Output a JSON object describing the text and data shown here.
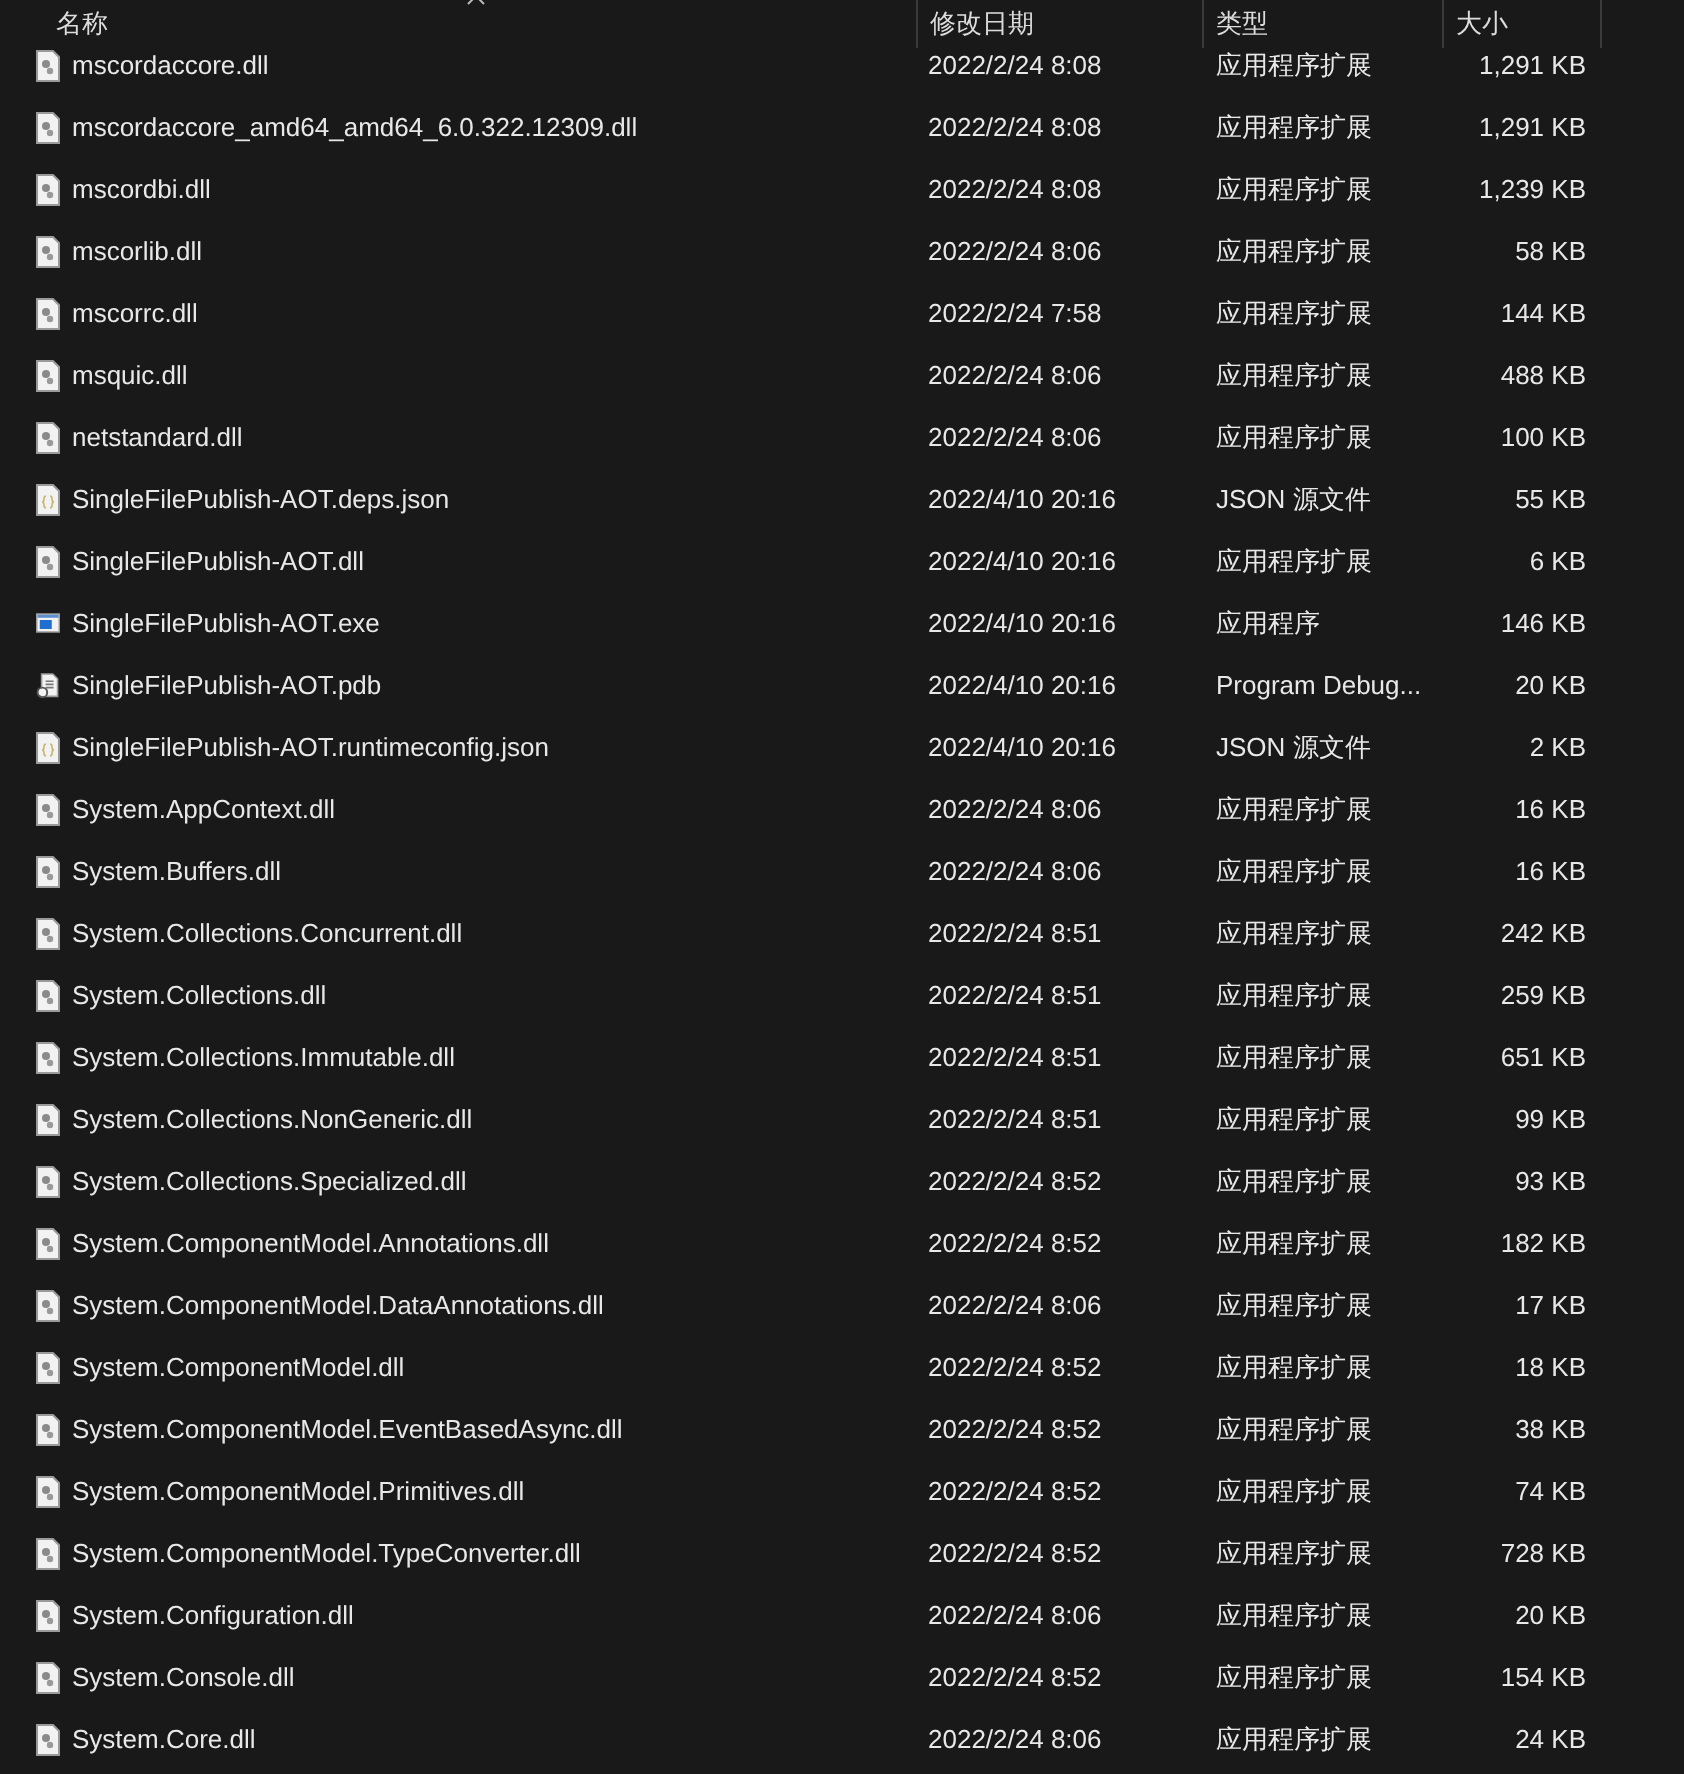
{
  "columns": [
    {
      "label": "名称",
      "sorted": true
    },
    {
      "label": "修改日期",
      "sorted": false
    },
    {
      "label": "类型",
      "sorted": false
    },
    {
      "label": "大小",
      "sorted": false
    }
  ],
  "files": [
    {
      "kind": "dll",
      "name": "mscordaccore.dll",
      "date": "2022/2/24 8:08",
      "type": "应用程序扩展",
      "size": "1,291 KB"
    },
    {
      "kind": "dll",
      "name": "mscordaccore_amd64_amd64_6.0.322.12309.dll",
      "date": "2022/2/24 8:08",
      "type": "应用程序扩展",
      "size": "1,291 KB"
    },
    {
      "kind": "dll",
      "name": "mscordbi.dll",
      "date": "2022/2/24 8:08",
      "type": "应用程序扩展",
      "size": "1,239 KB"
    },
    {
      "kind": "dll",
      "name": "mscorlib.dll",
      "date": "2022/2/24 8:06",
      "type": "应用程序扩展",
      "size": "58 KB"
    },
    {
      "kind": "dll",
      "name": "mscorrc.dll",
      "date": "2022/2/24 7:58",
      "type": "应用程序扩展",
      "size": "144 KB"
    },
    {
      "kind": "dll",
      "name": "msquic.dll",
      "date": "2022/2/24 8:06",
      "type": "应用程序扩展",
      "size": "488 KB"
    },
    {
      "kind": "dll",
      "name": "netstandard.dll",
      "date": "2022/2/24 8:06",
      "type": "应用程序扩展",
      "size": "100 KB"
    },
    {
      "kind": "json",
      "name": "SingleFilePublish-AOT.deps.json",
      "date": "2022/4/10 20:16",
      "type": "JSON 源文件",
      "size": "55 KB"
    },
    {
      "kind": "dll",
      "name": "SingleFilePublish-AOT.dll",
      "date": "2022/4/10 20:16",
      "type": "应用程序扩展",
      "size": "6 KB"
    },
    {
      "kind": "exe",
      "name": "SingleFilePublish-AOT.exe",
      "date": "2022/4/10 20:16",
      "type": "应用程序",
      "size": "146 KB"
    },
    {
      "kind": "pdb",
      "name": "SingleFilePublish-AOT.pdb",
      "date": "2022/4/10 20:16",
      "type": "Program Debug...",
      "size": "20 KB"
    },
    {
      "kind": "json",
      "name": "SingleFilePublish-AOT.runtimeconfig.json",
      "date": "2022/4/10 20:16",
      "type": "JSON 源文件",
      "size": "2 KB"
    },
    {
      "kind": "dll",
      "name": "System.AppContext.dll",
      "date": "2022/2/24 8:06",
      "type": "应用程序扩展",
      "size": "16 KB"
    },
    {
      "kind": "dll",
      "name": "System.Buffers.dll",
      "date": "2022/2/24 8:06",
      "type": "应用程序扩展",
      "size": "16 KB"
    },
    {
      "kind": "dll",
      "name": "System.Collections.Concurrent.dll",
      "date": "2022/2/24 8:51",
      "type": "应用程序扩展",
      "size": "242 KB"
    },
    {
      "kind": "dll",
      "name": "System.Collections.dll",
      "date": "2022/2/24 8:51",
      "type": "应用程序扩展",
      "size": "259 KB"
    },
    {
      "kind": "dll",
      "name": "System.Collections.Immutable.dll",
      "date": "2022/2/24 8:51",
      "type": "应用程序扩展",
      "size": "651 KB"
    },
    {
      "kind": "dll",
      "name": "System.Collections.NonGeneric.dll",
      "date": "2022/2/24 8:51",
      "type": "应用程序扩展",
      "size": "99 KB"
    },
    {
      "kind": "dll",
      "name": "System.Collections.Specialized.dll",
      "date": "2022/2/24 8:52",
      "type": "应用程序扩展",
      "size": "93 KB"
    },
    {
      "kind": "dll",
      "name": "System.ComponentModel.Annotations.dll",
      "date": "2022/2/24 8:52",
      "type": "应用程序扩展",
      "size": "182 KB"
    },
    {
      "kind": "dll",
      "name": "System.ComponentModel.DataAnnotations.dll",
      "date": "2022/2/24 8:06",
      "type": "应用程序扩展",
      "size": "17 KB"
    },
    {
      "kind": "dll",
      "name": "System.ComponentModel.dll",
      "date": "2022/2/24 8:52",
      "type": "应用程序扩展",
      "size": "18 KB"
    },
    {
      "kind": "dll",
      "name": "System.ComponentModel.EventBasedAsync.dll",
      "date": "2022/2/24 8:52",
      "type": "应用程序扩展",
      "size": "38 KB"
    },
    {
      "kind": "dll",
      "name": "System.ComponentModel.Primitives.dll",
      "date": "2022/2/24 8:52",
      "type": "应用程序扩展",
      "size": "74 KB"
    },
    {
      "kind": "dll",
      "name": "System.ComponentModel.TypeConverter.dll",
      "date": "2022/2/24 8:52",
      "type": "应用程序扩展",
      "size": "728 KB"
    },
    {
      "kind": "dll",
      "name": "System.Configuration.dll",
      "date": "2022/2/24 8:06",
      "type": "应用程序扩展",
      "size": "20 KB"
    },
    {
      "kind": "dll",
      "name": "System.Console.dll",
      "date": "2022/2/24 8:52",
      "type": "应用程序扩展",
      "size": "154 KB"
    },
    {
      "kind": "dll",
      "name": "System.Core.dll",
      "date": "2022/2/24 8:06",
      "type": "应用程序扩展",
      "size": "24 KB"
    }
  ]
}
